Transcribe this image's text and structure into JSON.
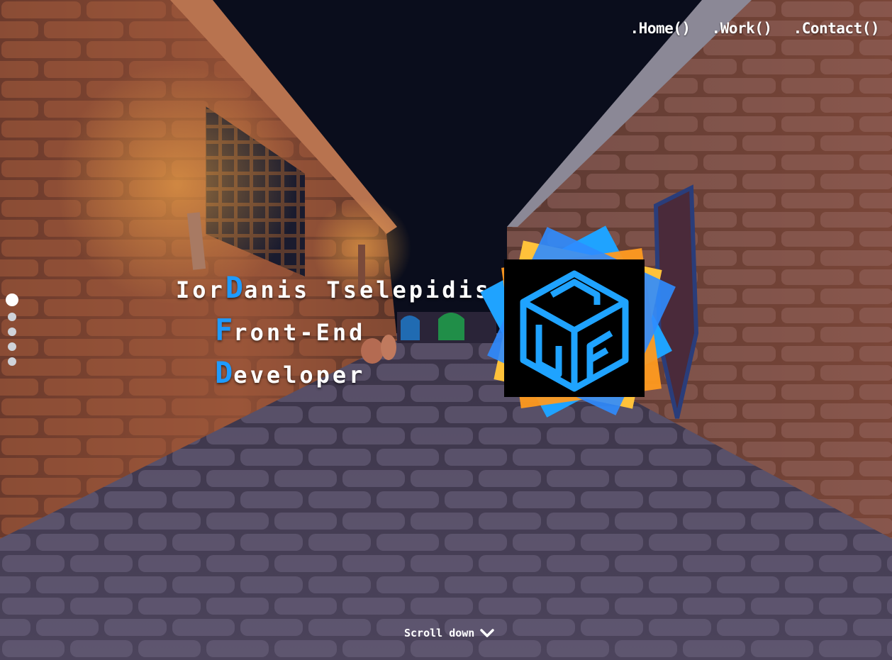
{
  "nav": {
    "home": ".Home()",
    "work": ".Work()",
    "contact": ".Contact()"
  },
  "hero": {
    "line1_prefix": "Ior",
    "line1_cap": "D",
    "line1_rest": "anis Tselepidis",
    "line2_cap": "F",
    "line2_rest": "ront-End",
    "line3_cap": "D",
    "line3_rest": "eveloper"
  },
  "scroll": {
    "label": "Scroll down",
    "icon": "chevron-down-icon"
  },
  "sections": {
    "count": 5,
    "active": 1
  },
  "colors": {
    "accent": "#1e9bff",
    "text": "#ffffff",
    "sky": "#0a0d1c",
    "logo_yellow": "#ffc23a",
    "logo_blue": "#1fa3ff",
    "logo_orange": "#ff9a1f"
  }
}
